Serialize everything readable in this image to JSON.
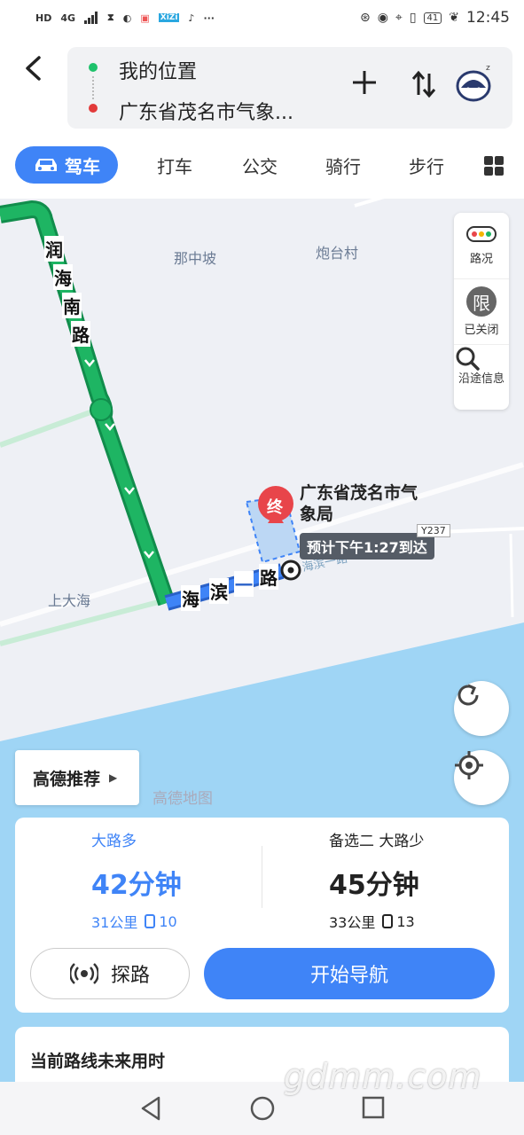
{
  "status_bar": {
    "left_icons": [
      "HD",
      "4G",
      "signal-icon",
      "hourglass-icon",
      "browser-icon",
      "app-icon",
      "XiZi",
      "tiktok-icon",
      "···"
    ],
    "battery": "41",
    "time": "12:45"
  },
  "header": {
    "from": "我的位置",
    "to": "广东省茂名市气象...",
    "add_icon": "plus-icon",
    "swap_icon": "swap-icon"
  },
  "tabs": [
    {
      "label": "驾车",
      "active": true
    },
    {
      "label": "打车"
    },
    {
      "label": "公交"
    },
    {
      "label": "骑行"
    },
    {
      "label": "步行"
    }
  ],
  "map": {
    "place_labels": [
      "那中坡",
      "炮台村",
      "上大海"
    ],
    "road_labels": {
      "vertical": [
        "润",
        "海",
        "南",
        "路"
      ],
      "horizontal": [
        "海",
        "滨",
        "一",
        "路"
      ],
      "faded": "海滨一路"
    },
    "destination_marker": "终",
    "destination_name": "广东省茂名市气象局",
    "eta": "预计下午1:27到达",
    "road_sign": "Y237",
    "watermark": "高德地图",
    "colors": {
      "route": "#1eb563",
      "sea": "#9fd5f5",
      "land": "#eef0f5",
      "accent": "#3f84f7",
      "marker": "#e8454a"
    }
  },
  "side_panel": {
    "traffic": "路况",
    "limit_icon_text": "限",
    "limit": "已关闭",
    "along_info": "沿途信息"
  },
  "recommend": "高德推荐",
  "routes": [
    {
      "tag": "大路多",
      "time": "42分钟",
      "distance": "31公里",
      "lights": "10"
    },
    {
      "tag": "备选二  大路少",
      "time": "45分钟",
      "distance": "33公里",
      "lights": "13"
    }
  ],
  "actions": {
    "explore": "探路",
    "navigate": "开始导航"
  },
  "future": {
    "title": "当前路线未来用时"
  },
  "site_watermark": "gdmm.com"
}
